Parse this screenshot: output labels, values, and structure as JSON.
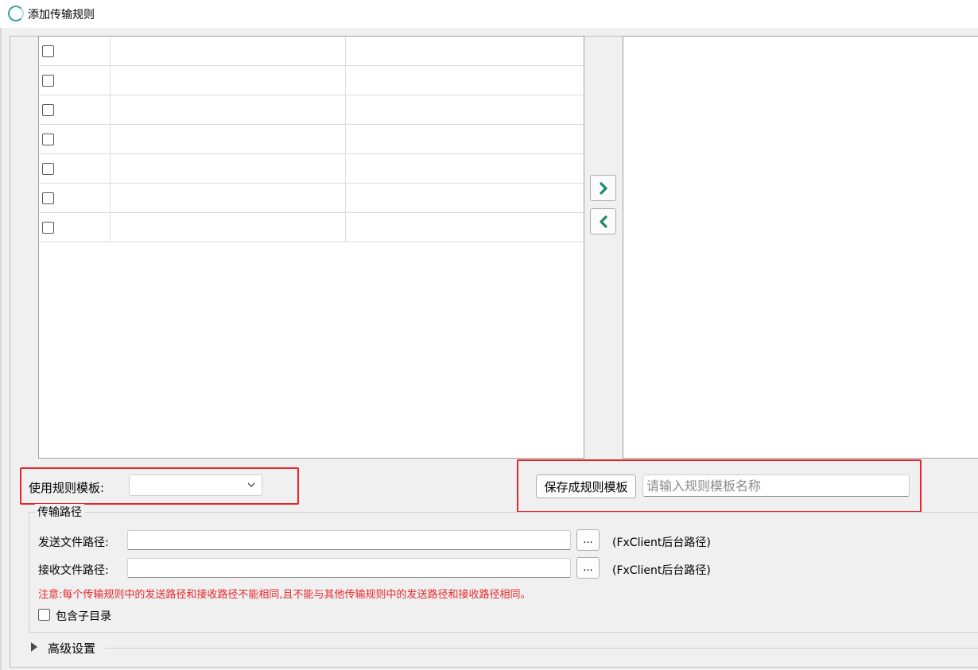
{
  "window": {
    "title": "添加传输规则"
  },
  "left_grid": {
    "rows": [
      {
        "col1": "",
        "col2": ""
      },
      {
        "col1": "",
        "col2": ""
      },
      {
        "col1": "",
        "col2": ""
      },
      {
        "col1": "",
        "col2": ""
      },
      {
        "col1": "",
        "col2": ""
      },
      {
        "col1": "",
        "col2": ""
      },
      {
        "col1": "",
        "col2": ""
      }
    ]
  },
  "transfer": {
    "add_icon": "chevron-right-icon",
    "remove_icon": "chevron-left-icon",
    "accent": "#1b8a6b"
  },
  "template": {
    "use_label": "使用规则模板:",
    "selected": "",
    "save_button": "保存成规则模板",
    "name_placeholder": "请输入规则模板名称"
  },
  "paths": {
    "group_title": "传输路径",
    "send_label": "发送文件路径:",
    "send_value": "",
    "receive_label": "接收文件路径:",
    "receive_value": "",
    "browse_label": "...",
    "hint": "(FxClient后台路径)",
    "note": "注意:每个传输规则中的发送路径和接收路径不能相同,且不能与其他传输规则中的发送路径和接收路径相同。",
    "include_subdir": "包含子目录"
  },
  "advanced": {
    "label": "高级设置"
  },
  "colors": {
    "highlight": "#e8262a",
    "note": "#e8262a"
  }
}
